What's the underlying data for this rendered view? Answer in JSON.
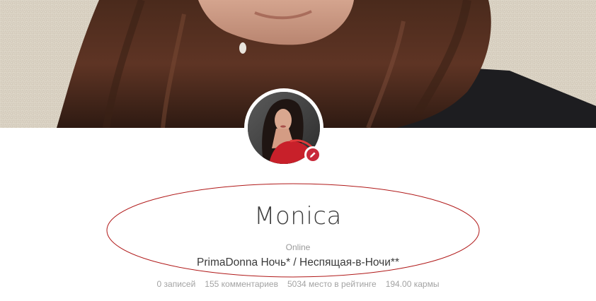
{
  "profile": {
    "username": "Monica",
    "status": "Online",
    "tagline": "PrimaDonna Ночь* / Неспящая-в-Ночи**",
    "stats": [
      "0 записей",
      "155 комментариев",
      "5034 место в рейтинге",
      "194.00 кармы"
    ]
  },
  "colors": {
    "accent": "#c8293a",
    "annotation": "#b01818",
    "username": "#3f3f3f",
    "muted": "#9a9a9a"
  },
  "icons": {
    "edit": "pencil-icon"
  }
}
